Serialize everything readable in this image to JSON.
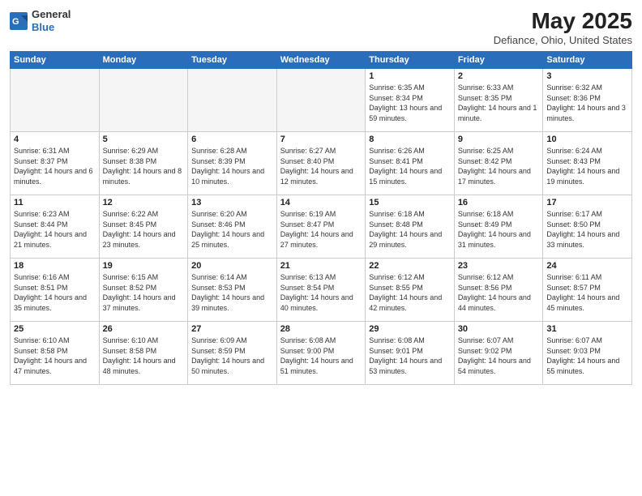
{
  "header": {
    "logo_general": "General",
    "logo_blue": "Blue",
    "month_title": "May 2025",
    "location": "Defiance, Ohio, United States"
  },
  "days_of_week": [
    "Sunday",
    "Monday",
    "Tuesday",
    "Wednesday",
    "Thursday",
    "Friday",
    "Saturday"
  ],
  "weeks": [
    [
      {
        "day": "",
        "empty": true
      },
      {
        "day": "",
        "empty": true
      },
      {
        "day": "",
        "empty": true
      },
      {
        "day": "",
        "empty": true
      },
      {
        "day": "1",
        "sunrise": "6:35 AM",
        "sunset": "8:34 PM",
        "daylight": "13 hours and 59 minutes."
      },
      {
        "day": "2",
        "sunrise": "6:33 AM",
        "sunset": "8:35 PM",
        "daylight": "14 hours and 1 minute."
      },
      {
        "day": "3",
        "sunrise": "6:32 AM",
        "sunset": "8:36 PM",
        "daylight": "14 hours and 3 minutes."
      }
    ],
    [
      {
        "day": "4",
        "sunrise": "6:31 AM",
        "sunset": "8:37 PM",
        "daylight": "14 hours and 6 minutes."
      },
      {
        "day": "5",
        "sunrise": "6:29 AM",
        "sunset": "8:38 PM",
        "daylight": "14 hours and 8 minutes."
      },
      {
        "day": "6",
        "sunrise": "6:28 AM",
        "sunset": "8:39 PM",
        "daylight": "14 hours and 10 minutes."
      },
      {
        "day": "7",
        "sunrise": "6:27 AM",
        "sunset": "8:40 PM",
        "daylight": "14 hours and 12 minutes."
      },
      {
        "day": "8",
        "sunrise": "6:26 AM",
        "sunset": "8:41 PM",
        "daylight": "14 hours and 15 minutes."
      },
      {
        "day": "9",
        "sunrise": "6:25 AM",
        "sunset": "8:42 PM",
        "daylight": "14 hours and 17 minutes."
      },
      {
        "day": "10",
        "sunrise": "6:24 AM",
        "sunset": "8:43 PM",
        "daylight": "14 hours and 19 minutes."
      }
    ],
    [
      {
        "day": "11",
        "sunrise": "6:23 AM",
        "sunset": "8:44 PM",
        "daylight": "14 hours and 21 minutes."
      },
      {
        "day": "12",
        "sunrise": "6:22 AM",
        "sunset": "8:45 PM",
        "daylight": "14 hours and 23 minutes."
      },
      {
        "day": "13",
        "sunrise": "6:20 AM",
        "sunset": "8:46 PM",
        "daylight": "14 hours and 25 minutes."
      },
      {
        "day": "14",
        "sunrise": "6:19 AM",
        "sunset": "8:47 PM",
        "daylight": "14 hours and 27 minutes."
      },
      {
        "day": "15",
        "sunrise": "6:18 AM",
        "sunset": "8:48 PM",
        "daylight": "14 hours and 29 minutes."
      },
      {
        "day": "16",
        "sunrise": "6:18 AM",
        "sunset": "8:49 PM",
        "daylight": "14 hours and 31 minutes."
      },
      {
        "day": "17",
        "sunrise": "6:17 AM",
        "sunset": "8:50 PM",
        "daylight": "14 hours and 33 minutes."
      }
    ],
    [
      {
        "day": "18",
        "sunrise": "6:16 AM",
        "sunset": "8:51 PM",
        "daylight": "14 hours and 35 minutes."
      },
      {
        "day": "19",
        "sunrise": "6:15 AM",
        "sunset": "8:52 PM",
        "daylight": "14 hours and 37 minutes."
      },
      {
        "day": "20",
        "sunrise": "6:14 AM",
        "sunset": "8:53 PM",
        "daylight": "14 hours and 39 minutes."
      },
      {
        "day": "21",
        "sunrise": "6:13 AM",
        "sunset": "8:54 PM",
        "daylight": "14 hours and 40 minutes."
      },
      {
        "day": "22",
        "sunrise": "6:12 AM",
        "sunset": "8:55 PM",
        "daylight": "14 hours and 42 minutes."
      },
      {
        "day": "23",
        "sunrise": "6:12 AM",
        "sunset": "8:56 PM",
        "daylight": "14 hours and 44 minutes."
      },
      {
        "day": "24",
        "sunrise": "6:11 AM",
        "sunset": "8:57 PM",
        "daylight": "14 hours and 45 minutes."
      }
    ],
    [
      {
        "day": "25",
        "sunrise": "6:10 AM",
        "sunset": "8:58 PM",
        "daylight": "14 hours and 47 minutes."
      },
      {
        "day": "26",
        "sunrise": "6:10 AM",
        "sunset": "8:58 PM",
        "daylight": "14 hours and 48 minutes."
      },
      {
        "day": "27",
        "sunrise": "6:09 AM",
        "sunset": "8:59 PM",
        "daylight": "14 hours and 50 minutes."
      },
      {
        "day": "28",
        "sunrise": "6:08 AM",
        "sunset": "9:00 PM",
        "daylight": "14 hours and 51 minutes."
      },
      {
        "day": "29",
        "sunrise": "6:08 AM",
        "sunset": "9:01 PM",
        "daylight": "14 hours and 53 minutes."
      },
      {
        "day": "30",
        "sunrise": "6:07 AM",
        "sunset": "9:02 PM",
        "daylight": "14 hours and 54 minutes."
      },
      {
        "day": "31",
        "sunrise": "6:07 AM",
        "sunset": "9:03 PM",
        "daylight": "14 hours and 55 minutes."
      }
    ]
  ]
}
